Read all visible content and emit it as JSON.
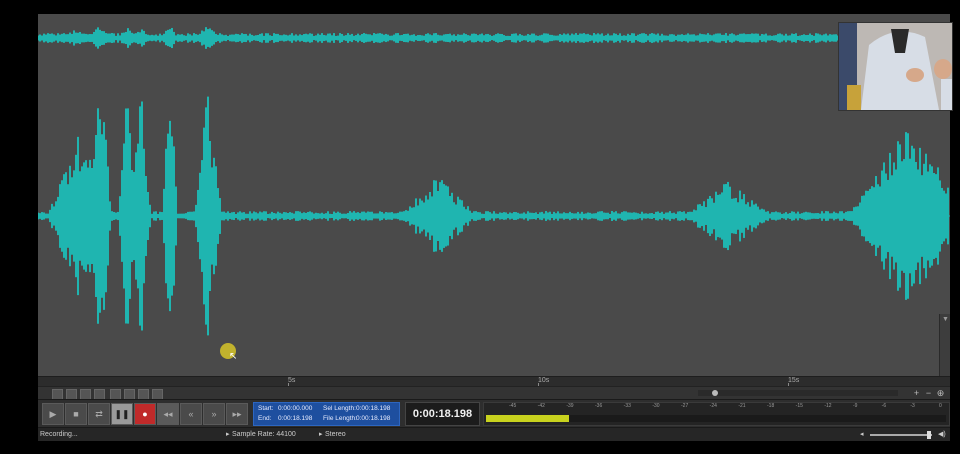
{
  "colors": {
    "waveform": "#1fb5b0",
    "background": "#4a4a4a",
    "record_button": "#c02a2a",
    "selection_box": "#1e4f9f",
    "meter_fill": "#c8d21e"
  },
  "timeline": {
    "labels": [
      "5s",
      "10s",
      "15s"
    ]
  },
  "transport": {
    "icons": [
      "play-icon",
      "stop-icon",
      "loop-icon",
      "pause-icon",
      "record-icon",
      "go-to-start-icon",
      "rewind-icon",
      "fast-forward-icon",
      "go-to-end-icon"
    ]
  },
  "selection": {
    "start_label": "Start:",
    "start_value": "0:00:00.000",
    "end_label": "End:",
    "end_value": "0:00:18.198",
    "sel_length_label": "Sel Length:",
    "sel_length_value": "0:00:18.198",
    "file_length_label": "File Length:",
    "file_length_value": "0:00:18.198"
  },
  "current_time": "0:00:18.198",
  "meter": {
    "scale": [
      "-45",
      "-42",
      "-39",
      "-36",
      "-33",
      "-30",
      "-27",
      "-24",
      "-21",
      "-18",
      "-15",
      "-12",
      "-9",
      "-6",
      "-3",
      "0"
    ],
    "level_fraction": 0.18
  },
  "status": {
    "state": "Recording...",
    "sample_rate_label": "Sample Rate: 44100",
    "channels_label": "Stereo"
  },
  "volume": {
    "level_fraction": 0.95
  }
}
